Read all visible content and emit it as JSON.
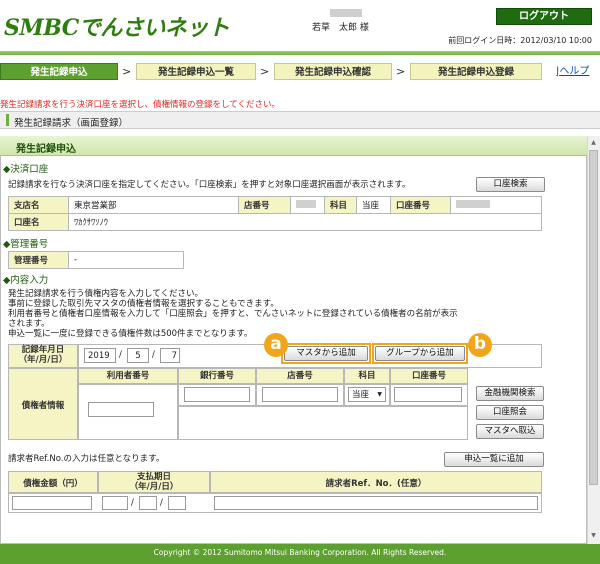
{
  "header": {
    "logo": "SMBCでんさいネット",
    "user_name": "若草　太郎 様",
    "logout_label": "ログアウト",
    "last_login": "前回ログイン日時：2012/03/10 10:00"
  },
  "steps": [
    {
      "label": "発生記録申込",
      "state": "active"
    },
    {
      "label": "発生記録申込一覧",
      "state": "inactive"
    },
    {
      "label": "発生記録申込確認",
      "state": "inactive"
    },
    {
      "label": "発生記録申込登録",
      "state": "inactive"
    }
  ],
  "step_separator": ">",
  "help_link": "ヘルプ",
  "instruction": "発生記録請求を行う決済口座を選択し、債権情報の登録をしてください。",
  "screen_title": "発生記録請求（画面登録）",
  "section_title": "発生記録申込",
  "settlement": {
    "heading": "◆決済口座",
    "desc": "記録請求を行なう決済口座を指定してください。「口座検索」を押すと対象口座選択画面が表示されます。",
    "search_button": "口座検索",
    "labels": {
      "branch": "支店名",
      "branch_no": "店番号",
      "subject": "科目",
      "account_no": "口座番号",
      "account_name": "口座名"
    },
    "values": {
      "branch": "東京営業部",
      "subject": "当座",
      "account_name": "ﾜｶｸｻﾜｿﾉｳ"
    }
  },
  "management": {
    "heading": "◆管理番号",
    "label": "管理番号",
    "value": "-"
  },
  "content": {
    "heading": "◆内容入力",
    "desc_lines": [
      "発生記録請求を行う債権内容を入力してください。",
      "事前に登録した取引先マスタの債権者情報を選択することもできます。",
      "利用者番号と債権者口座情報を入力して「口座照会」を押すと、でんさいネットに登録されている債権者の名前が表示",
      "されます。",
      "申込一覧に一度に登録できる債権件数は500件までとなります。"
    ]
  },
  "entry": {
    "record_date_label": "記録年月日\n（年/月/日）",
    "date_year": "2019",
    "date_month": "5",
    "date_day": "7",
    "date_sep": "/",
    "master_add_button": "マスタから追加",
    "group_add_button": "グループから追加",
    "creditor_label": "債権者情報",
    "col_headers": [
      "利用者番号",
      "銀行番号",
      "店番号",
      "科目",
      "口座番号"
    ],
    "subject_value": "当座",
    "bank_search_button": "金融機関検索",
    "account_inquiry_button": "口座照会",
    "master_import_button": "マスタへ取込"
  },
  "ref_note": "請求者Ref.No.の入力は任意となります。",
  "add_to_list_button": "申込一覧に追加",
  "amount_table": {
    "headers": [
      "債権金額（円）",
      "支払期日\n（年/月/日）",
      "請求者Ref．No．(任意）"
    ],
    "date_sep": "/"
  },
  "callouts": {
    "a": "a",
    "b": "b"
  },
  "colors": {
    "brand_green": "#5da030",
    "accent_orange": "#f0a51a",
    "error_red": "#e8261f"
  },
  "footer": "Copyright © 2012 Sumitomo Mitsui Banking Corporation. All Rights Reserved."
}
